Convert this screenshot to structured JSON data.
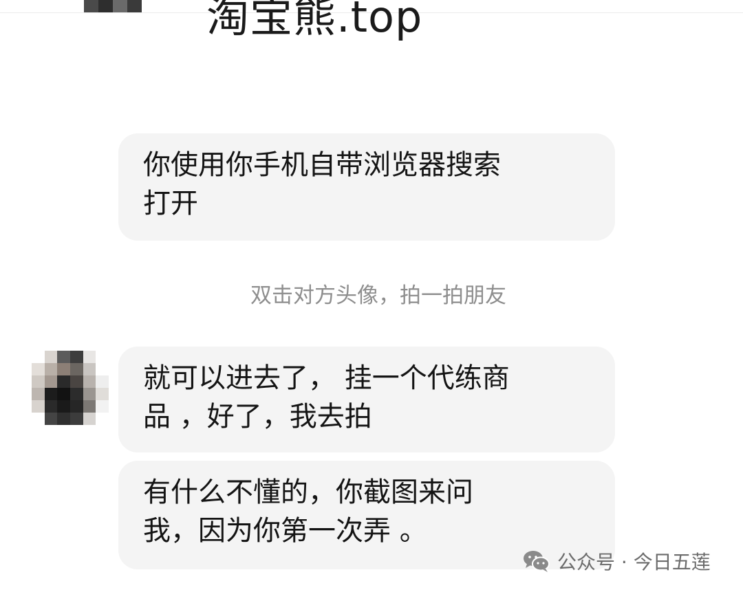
{
  "previous_message": {
    "cropped_text": "淘宝熊.top"
  },
  "messages": [
    {
      "text": "你使用你手机自带浏览器搜索\n打开"
    },
    {
      "text": "就可以进去了， 挂一个代练商\n品 ，好了，我去拍"
    },
    {
      "text": "有什么不懂的，你截图来问\n我，因为你第一次弄 。"
    }
  ],
  "system_notice": "双击对方头像，拍一拍朋友",
  "watermark": {
    "icon": "wechat-icon",
    "text": "公众号 · 今日五莲"
  },
  "colors": {
    "bubble_background": "#f4f4f4",
    "notice_text": "#8e8e8e",
    "watermark_text": "#6b6b6b"
  }
}
